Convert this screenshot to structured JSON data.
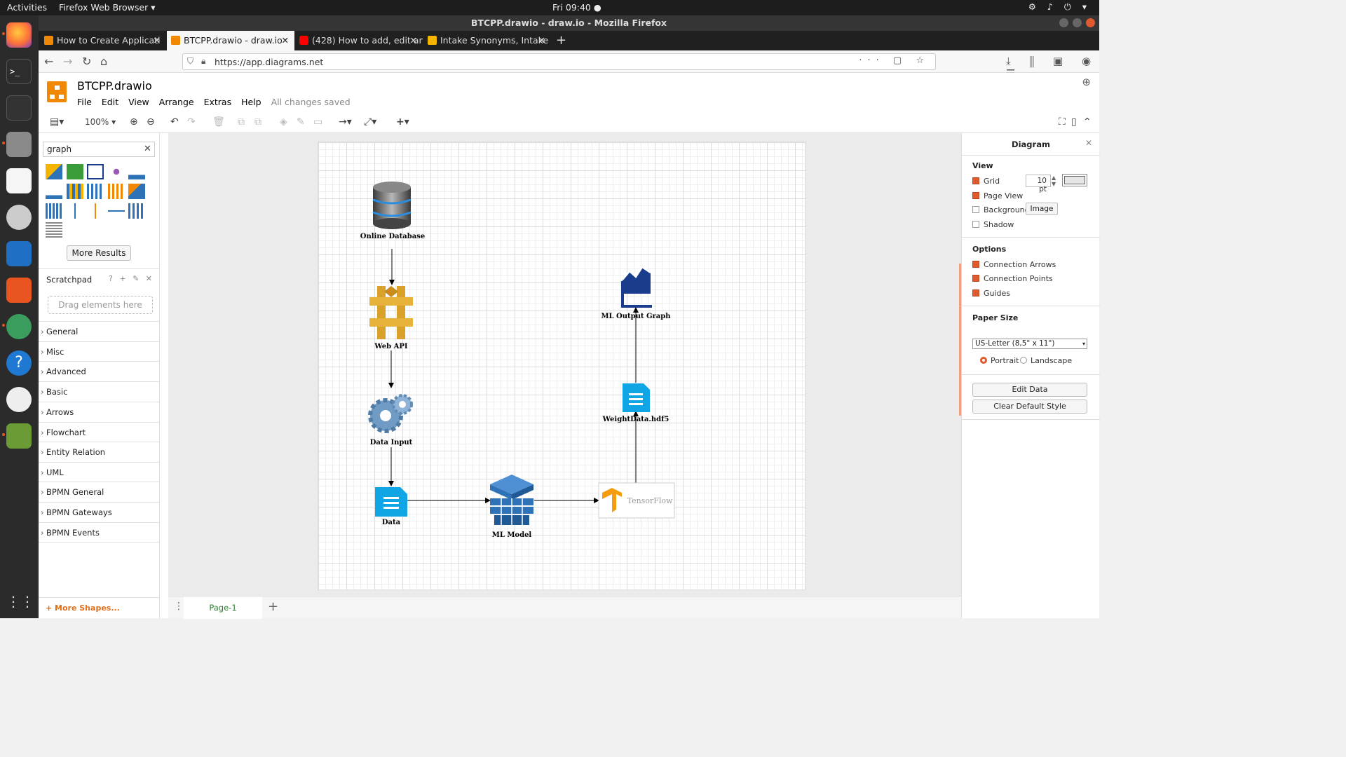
{
  "system": {
    "activities": "Activities",
    "app_name": "Firefox Web Browser ▾",
    "clock": "Fri 09:40 ●"
  },
  "window": {
    "title": "BTCPP.drawio - draw.io - Mozilla Firefox"
  },
  "tabs": [
    {
      "label": "How to Create Applicati"
    },
    {
      "label": "BTCPP.drawio - draw.io"
    },
    {
      "label": "(428) How to add, edit an"
    },
    {
      "label": "Intake Synonyms, Intake"
    }
  ],
  "address": {
    "url": "https://app.diagrams.net"
  },
  "drawio": {
    "doc_title": "BTCPP.drawio",
    "menus": [
      "File",
      "Edit",
      "View",
      "Arrange",
      "Extras",
      "Help"
    ],
    "save_status": "All changes saved",
    "zoom": "100% ▾"
  },
  "sidebar": {
    "search_value": "graph",
    "more_results": "More Results",
    "scratchpad": "Scratchpad",
    "scratchpad_tools": "? + ✎ ✕",
    "drop_hint": "Drag elements here",
    "categories": [
      "General",
      "Misc",
      "Advanced",
      "Basic",
      "Arrows",
      "Flowchart",
      "Entity Relation",
      "UML",
      "BPMN General",
      "BPMN Gateways",
      "BPMN Events"
    ],
    "more_shapes": "+ More Shapes..."
  },
  "diagram": {
    "nodes": {
      "database": "Online Database",
      "webapi": "Web API",
      "datainput": "Data Input",
      "data": "Data",
      "mlmodel": "ML Model",
      "tensorflow": "TensorFlow",
      "weights": "WeightData.hdf5",
      "graph": "ML Output Graph"
    }
  },
  "pages": {
    "tab": "Page-1"
  },
  "format_panel": {
    "title": "Diagram",
    "view_heading": "View",
    "grid": "Grid",
    "grid_size": "10 pt",
    "page_view": "Page View",
    "background": "Background",
    "image_button": "Image",
    "shadow": "Shadow",
    "options_heading": "Options",
    "connection_arrows": "Connection Arrows",
    "connection_points": "Connection Points",
    "guides": "Guides",
    "paper_heading": "Paper Size",
    "paper_size": "US-Letter (8,5\" x 11\")",
    "portrait": "Portrait",
    "landscape": "Landscape",
    "edit_data": "Edit Data",
    "clear_style": "Clear Default Style"
  },
  "colors": {
    "accent": "#e05a2f",
    "drawio_orange": "#f08705",
    "icon_blue": "#10a5e5",
    "aws_blue": "#2e73b8"
  }
}
